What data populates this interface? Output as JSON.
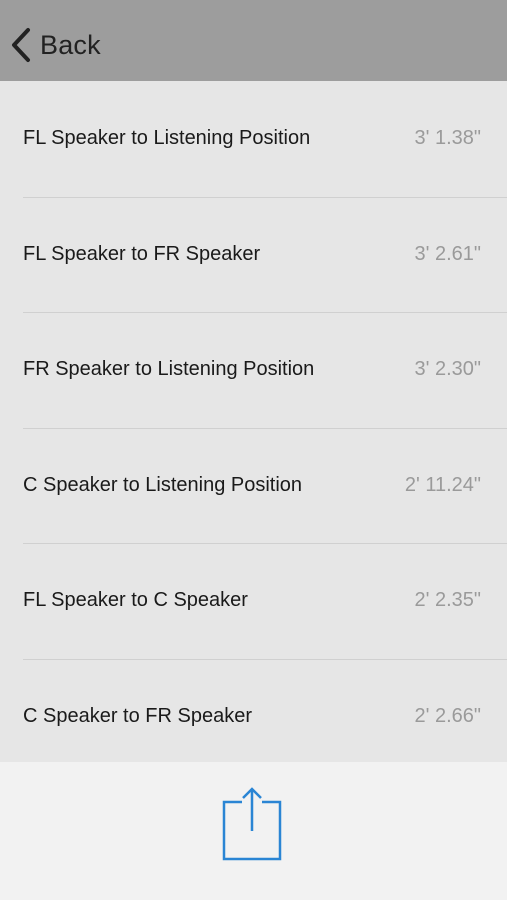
{
  "nav": {
    "back_label": "Back"
  },
  "measurements": [
    {
      "label": "FL Speaker to Listening Position",
      "value": "3' 1.38\""
    },
    {
      "label": "FL Speaker to FR Speaker",
      "value": "3' 2.61\""
    },
    {
      "label": "FR Speaker to Listening Position",
      "value": "3' 2.30\""
    },
    {
      "label": "C Speaker to Listening Position",
      "value": "2' 11.24\""
    },
    {
      "label": "FL Speaker to C Speaker",
      "value": "2' 2.35\""
    },
    {
      "label": "C Speaker to FR Speaker",
      "value": "2' 2.66\""
    }
  ],
  "toolbar": {
    "share_icon": "share-icon"
  },
  "colors": {
    "nav_background": "#9d9d9d",
    "list_background": "#e6e6e6",
    "accent": "#2a85d4"
  }
}
